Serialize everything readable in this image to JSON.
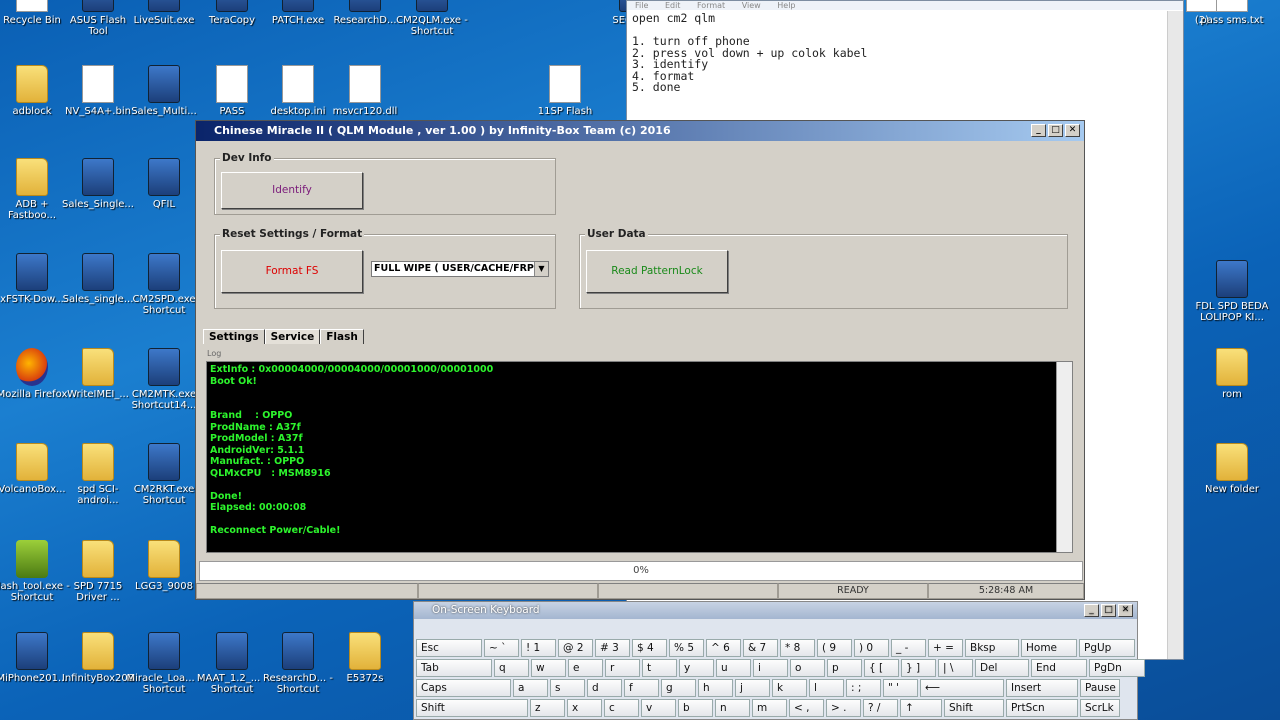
{
  "desktop": {
    "icons": [
      {
        "label": "Recycle Bin",
        "icon": "recycle-bin-icon"
      },
      {
        "label": "ASUS Flash Tool",
        "icon": "app-icon"
      },
      {
        "label": "LiveSuit.exe",
        "icon": "app-icon"
      },
      {
        "label": "TeraCopy",
        "icon": "app-icon"
      },
      {
        "label": "PATCH.exe",
        "icon": "app-icon"
      },
      {
        "label": "ResearchD...",
        "icon": "app-icon"
      },
      {
        "label": "CM2QLM.exe - Shortcut",
        "icon": "app-icon"
      },
      {
        "label": "SEC BOO",
        "icon": "app-icon"
      },
      {
        "label": "adblock",
        "icon": "folder-icon"
      },
      {
        "label": "NV_S4A+.bin",
        "icon": "file-icon"
      },
      {
        "label": "Sales_Multi...",
        "icon": "app-icon"
      },
      {
        "label": "PASS",
        "icon": "file-icon"
      },
      {
        "label": "desktop.ini",
        "icon": "file-icon"
      },
      {
        "label": "msvcr120.dll",
        "icon": "file-icon"
      },
      {
        "label": "11SP Flash",
        "icon": "file-icon"
      },
      {
        "label": "ADB + Fastboo...",
        "icon": "folder-icon"
      },
      {
        "label": "Sales_Single...",
        "icon": "app-icon"
      },
      {
        "label": "QFIL",
        "icon": "app-icon"
      },
      {
        "label": "xFSTK-Dow...",
        "icon": "app-icon"
      },
      {
        "label": "Sales_single...",
        "icon": "app-icon"
      },
      {
        "label": "CM2SPD.exe Shortcut",
        "icon": "app-icon"
      },
      {
        "label": "Mozilla Firefox",
        "icon": "firefox-icon"
      },
      {
        "label": "WriteIMEI_...",
        "icon": "folder-icon"
      },
      {
        "label": "CM2MTK.exe Shortcut14...",
        "icon": "app-icon"
      },
      {
        "label": "VolcanoBox...",
        "icon": "folder-icon"
      },
      {
        "label": "spd SCI-androi...",
        "icon": "folder-icon"
      },
      {
        "label": "CM2RKT.exe Shortcut",
        "icon": "app-icon"
      },
      {
        "label": "flash_tool.exe - Shortcut",
        "icon": "android-icon"
      },
      {
        "label": "SPD 7715 Driver ...",
        "icon": "folder-icon"
      },
      {
        "label": "LGG3_9008",
        "icon": "folder-icon"
      },
      {
        "label": "MiPhone201...",
        "icon": "app-icon"
      },
      {
        "label": "InfinityBox208",
        "icon": "folder-icon"
      },
      {
        "label": "Miracle_Loa... - Shortcut",
        "icon": "app-icon"
      },
      {
        "label": "MAAT_1.2_... - Shortcut",
        "icon": "app-icon"
      },
      {
        "label": "ResearchD... - Shortcut",
        "icon": "app-icon"
      },
      {
        "label": "E5372s",
        "icon": "folder-icon"
      },
      {
        "label": "(2)",
        "icon": "file-icon"
      },
      {
        "label": "pass sms.txt",
        "icon": "file-icon"
      },
      {
        "label": "FDL SPD BEDA LOLIPOP KI...",
        "icon": "app-icon"
      },
      {
        "label": "rom",
        "icon": "folder-icon"
      },
      {
        "label": "New folder",
        "icon": "folder-icon"
      }
    ]
  },
  "notepad": {
    "menu": [
      "File",
      "Edit",
      "Format",
      "View",
      "Help"
    ],
    "text": "open cm2 qlm\n\n1. turn off phone\n2. press vol down + up colok kabel\n3. identify\n4. format\n5. done"
  },
  "cm2": {
    "title": "Chinese Miracle II ( QLM Module , ver 1.00 ) by Infinity-Box Team (c) 2016",
    "dev_info": {
      "legend": "Dev Info",
      "identify": "Identify"
    },
    "reset": {
      "legend": "Reset Settings / Format",
      "format": "Format FS",
      "wipe_option": "FULL WIPE ( USER/CACHE/FRP )"
    },
    "user_data": {
      "legend": "User Data",
      "read_pattern": "Read PatternLock"
    },
    "tabs": [
      "Settings",
      "Service",
      "Flash"
    ],
    "log_label": "Log",
    "log_lines": [
      "ExtInfo : 0x00004000/00004000/00001000/00001000",
      "Boot Ok!",
      "",
      "",
      "Brand    : OPPO",
      "ProdName : A37f",
      "ProdModel : A37f",
      "AndroidVer: 5.1.1",
      "Manufact. : OPPO",
      "QLMxCPU   : MSM8916",
      "",
      "Done!",
      "Elapsed: 00:00:08",
      "",
      "Reconnect Power/Cable!"
    ],
    "progress": "0%",
    "status": "READY",
    "time": "5:28:48 AM"
  },
  "osk": {
    "title": "On-Screen Keyboard",
    "rows": [
      [
        "Esc",
        "~ `",
        "! 1",
        "@ 2",
        "# 3",
        "$ 4",
        "% 5",
        "^ 6",
        "& 7",
        "* 8",
        "( 9",
        ") 0",
        "_ -",
        "+ =",
        "Bksp",
        "Home",
        "PgUp"
      ],
      [
        "Tab",
        "q",
        "w",
        "e",
        "r",
        "t",
        "y",
        "u",
        "i",
        "o",
        "p",
        "{ [",
        "} ]",
        "| \\",
        "Del",
        "End",
        "PgDn"
      ],
      [
        "Caps",
        "a",
        "s",
        "d",
        "f",
        "g",
        "h",
        "j",
        "k",
        "l",
        ": ;",
        "\" '",
        "⟵",
        "Insert",
        "Pause"
      ],
      [
        "Shift",
        "z",
        "x",
        "c",
        "v",
        "b",
        "n",
        "m",
        "< ,",
        "> .",
        "? /",
        "↑",
        "Shift",
        "PrtScn",
        "ScrLk"
      ]
    ]
  }
}
